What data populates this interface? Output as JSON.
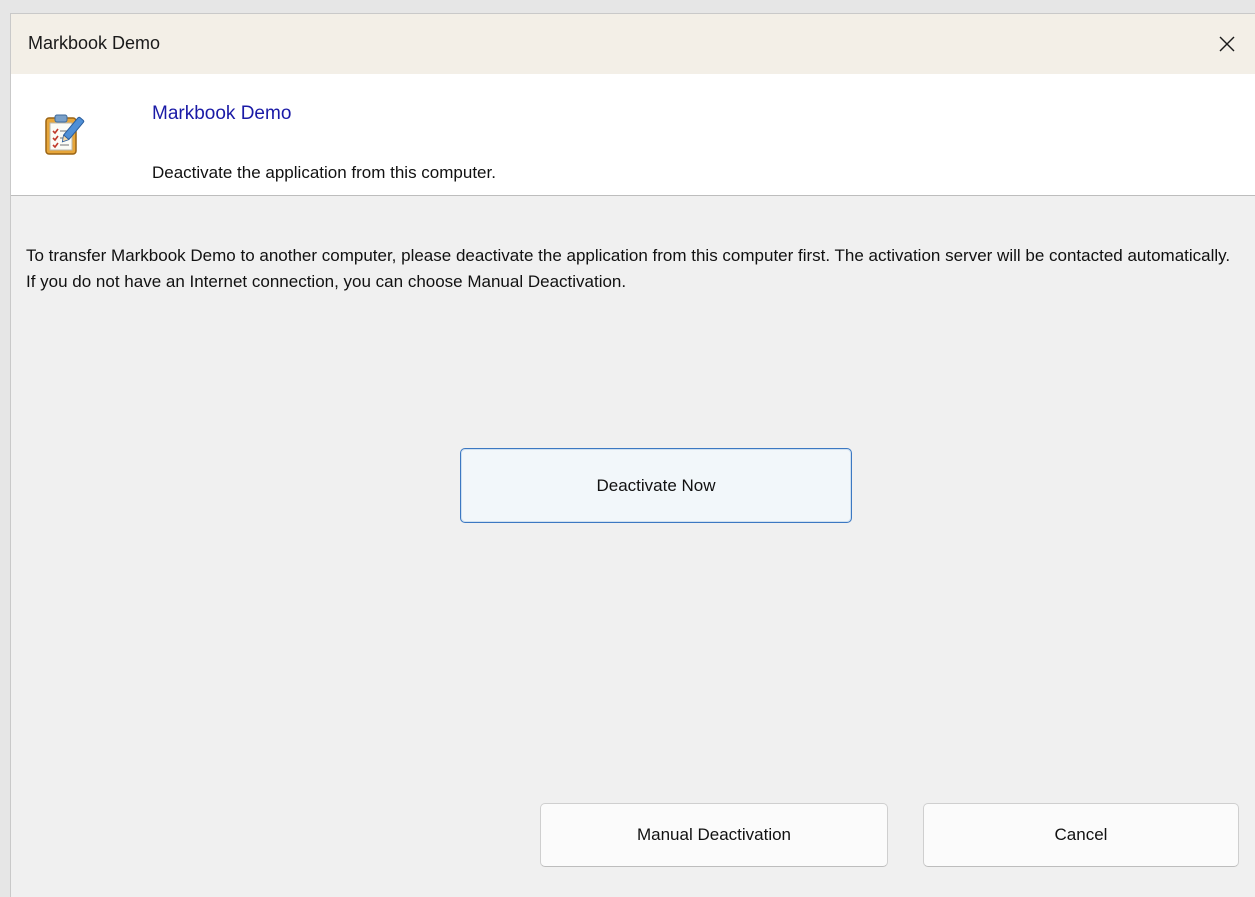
{
  "window": {
    "title": "Markbook Demo",
    "close_glyph": "✕"
  },
  "header": {
    "icon": "markbook-app-icon",
    "title": "Markbook Demo",
    "subtitle": "Deactivate the application from this computer."
  },
  "body": {
    "description": "To transfer Markbook Demo to another computer, please deactivate the application from this computer first. The activation server will be contacted automatically. If you do not have an Internet connection, you can choose Manual Deactivation."
  },
  "buttons": {
    "deactivate_now": "Deactivate Now",
    "manual_deactivation": "Manual Deactivation",
    "cancel": "Cancel"
  },
  "colors": {
    "title_bar": "#f3efe7",
    "header_background": "#ffffff",
    "dialog_background": "#f0f0f0",
    "header_title_text": "#1a1aa6",
    "primary_button_border": "#3c78c2"
  }
}
